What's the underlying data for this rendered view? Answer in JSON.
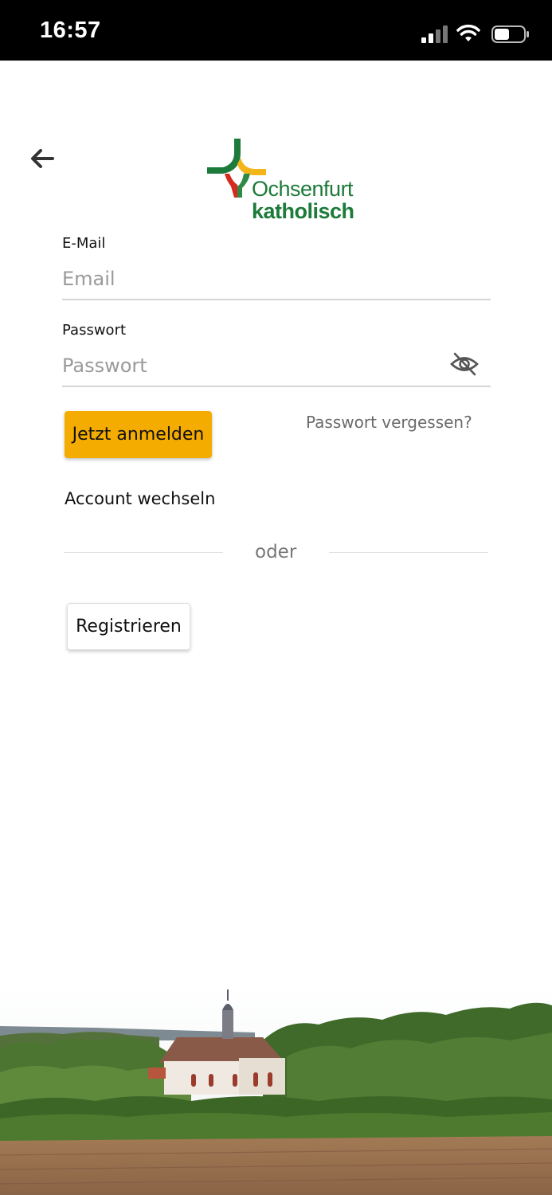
{
  "status_bar": {
    "time": "16:57",
    "icons": [
      "signal-icon",
      "wifi-icon",
      "battery-icon"
    ]
  },
  "header": {
    "back_icon": "arrow-left-icon",
    "logo": {
      "line1": "Ochsenfurt",
      "line2": "katholisch"
    }
  },
  "form": {
    "email": {
      "label": "E-Mail",
      "placeholder": "Email",
      "value": ""
    },
    "password": {
      "label": "Passwort",
      "placeholder": "Passwort",
      "value": "",
      "toggle_icon": "eye-off-icon"
    },
    "login_label": "Jetzt anmelden",
    "forgot_label": "Passwort vergessen?",
    "switch_account_label": "Account wechseln",
    "divider_label": "oder",
    "register_label": "Registrieren"
  },
  "colors": {
    "accent": "#f5ac00",
    "logo_green": "#1c7a3a",
    "logo_red": "#d52b1e",
    "logo_yellow": "#f2b51a"
  }
}
